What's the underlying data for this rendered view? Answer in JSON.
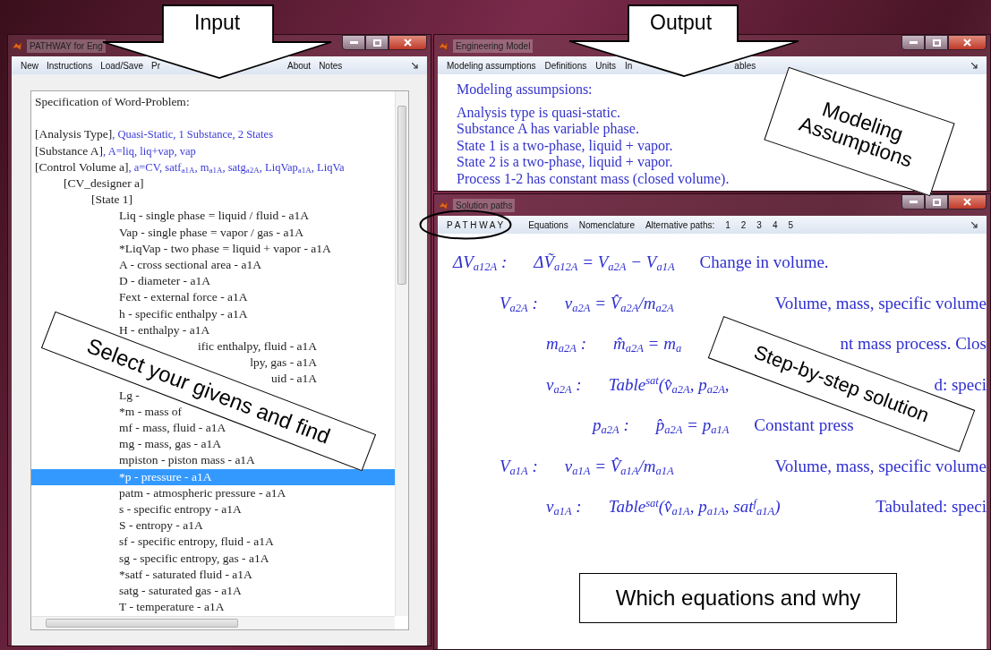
{
  "input_window": {
    "title": "PATHWAY for Eng",
    "menu": [
      "New",
      "Instructions",
      "Load/Save",
      "Pr",
      "About",
      "Notes"
    ],
    "heading": "Specification of Word-Problem:",
    "specs": [
      {
        "label": "[Analysis Type]",
        "value": ", Quasi-Static, 1 Substance, 2 States"
      },
      {
        "label": "[Substance A]",
        "value": ", A=liq, liq+vap, vap"
      },
      {
        "label": "[Control Volume a]",
        "value": ", a=CV, satf$_{a1A}$, m$_{a1A}$, satg$_{a2A}$, LiqVap$_{a1A}$, LiqVa"
      }
    ],
    "tree": [
      {
        "text": "[CV_designer a]",
        "selected": false,
        "children": [
          {
            "text": "[State 1]",
            "selected": false,
            "children": [
              {
                "text": "Liq - single phase = liquid / fluid - a1A",
                "selected": false,
                "kind": "entry"
              },
              {
                "text": "Vap - single phase = vapor / gas - a1A",
                "selected": false,
                "kind": "entry"
              },
              {
                "text": "*LiqVap - two phase = liquid + vapor - a1A",
                "selected": false,
                "kind": "entry"
              },
              {
                "text": "A - cross sectional area - a1A",
                "selected": false,
                "kind": "entry"
              },
              {
                "text": "D - diameter - a1A",
                "selected": false,
                "kind": "entry"
              },
              {
                "text": "Fext - external force - a1A",
                "selected": false,
                "kind": "entry"
              },
              {
                "text": "h - specific enthalpy - a1A",
                "selected": false,
                "kind": "entry"
              },
              {
                "text": "H - enthalpy - a1A",
                "selected": false,
                "kind": "entry"
              },
              {
                "text": "ific enthalpy, fluid - a1A",
                "selected": false,
                "kind": "tail"
              },
              {
                "text": "lpy, gas - a1A",
                "selected": false,
                "kind": "tail"
              },
              {
                "text": "uid - a1A",
                "selected": false,
                "kind": "tail"
              },
              {
                "text": "Lg -",
                "selected": false,
                "kind": "entry"
              },
              {
                "text": "*m - mass of",
                "selected": false,
                "kind": "entry"
              },
              {
                "text": "mf - mass, fluid - a1A",
                "selected": false,
                "kind": "entry"
              },
              {
                "text": "mg - mass, gas - a1A",
                "selected": false,
                "kind": "entry"
              },
              {
                "text": "mpiston - piston mass - a1A",
                "selected": false,
                "kind": "entry"
              },
              {
                "text": "*p - pressure - a1A",
                "selected": true,
                "kind": "entry"
              },
              {
                "text": "patm - atmospheric pressure - a1A",
                "selected": false,
                "kind": "entry"
              },
              {
                "text": "s - specific entropy - a1A",
                "selected": false,
                "kind": "entry"
              },
              {
                "text": "S - entropy - a1A",
                "selected": false,
                "kind": "entry"
              },
              {
                "text": "sf - specific entropy, fluid - a1A",
                "selected": false,
                "kind": "entry"
              },
              {
                "text": "sg - specific entropy, gas - a1A",
                "selected": false,
                "kind": "entry"
              },
              {
                "text": "*satf - saturated fluid - a1A",
                "selected": false,
                "kind": "entry"
              },
              {
                "text": "satg - saturated gas - a1A",
                "selected": false,
                "kind": "entry"
              },
              {
                "text": "T - temperature - a1A",
                "selected": false,
                "kind": "entry"
              }
            ]
          }
        ]
      }
    ]
  },
  "model_window": {
    "title": "Engineering Model",
    "menu": [
      "Modeling assumptions",
      "Definitions",
      "Units",
      "In",
      "ables"
    ],
    "heading": "Modeling assumpsions:",
    "assumptions": [
      "Analysis type is quasi-static.",
      "Substance A has variable phase.",
      "State 1 is a two-phase, liquid + vapor.",
      "State 2 is a two-phase, liquid + vapor.",
      "Process 1-2 has constant mass (closed volume)."
    ]
  },
  "solution_window": {
    "title": "Solution paths",
    "menu": [
      "P A T H W A Y",
      "Equations",
      "Nomenclature",
      "Alternative paths:",
      "1",
      "2",
      "3",
      "4",
      "5"
    ],
    "equations": [
      {
        "variable": "ΔV$_{a12A}$ :",
        "equation": "ΔṼ$_{a12A}$ = V$_{a2A}$ − V$_{a1A}$",
        "reason": "Change in volume.",
        "clipped": false,
        "children": [
          {
            "variable": "V$_{a2A}$ :",
            "equation": "v$_{a2A}$ = V̂$_{a2A}$/m$_{a2A}$",
            "reason": "Volume, mass, specific volume",
            "clipped": true,
            "children": [
              {
                "variable": "m$_{a2A}$ :",
                "equation": "m̂$_{a2A}$ = m$_{a}$",
                "reason": "nt mass process. Clos",
                "clipped": true
              },
              {
                "variable": "v$_{a2A}$ :",
                "equation": "Table$^{sat}$(v̂$_{a2A}$, p$_{a2A}$,",
                "reason": "d: speci",
                "clipped": true,
                "children": [
                  {
                    "variable": "p$_{a2A}$ :",
                    "equation": "p̂$_{a2A}$ = p$_{a1A}$",
                    "reason": "Constant press",
                    "clipped": false
                  }
                ]
              }
            ]
          },
          {
            "variable": "V$_{a1A}$ :",
            "equation": "v$_{a1A}$ = V̂$_{a1A}$/m$_{a1A}$",
            "reason": "Volume, mass, specific volume",
            "clipped": true,
            "children": [
              {
                "variable": "v$_{a1A}$ :",
                "equation": "Table$^{sat}$(v̂$_{a1A}$, p$_{a1A}$, sat$^{f}$$_{a1A}$)",
                "reason": "Tabulated: speci",
                "clipped": true
              }
            ]
          }
        ]
      }
    ]
  },
  "annotations": [
    {
      "kind": "arrow",
      "text": "Input"
    },
    {
      "kind": "arrow",
      "text": "Output"
    },
    {
      "kind": "tilted",
      "text": "Modeling Assumptions"
    },
    {
      "kind": "tilted",
      "text": "Select your givens and find"
    },
    {
      "kind": "tilted",
      "text": "Step-by-step solution"
    },
    {
      "kind": "box",
      "text": "Which equations and why"
    },
    {
      "kind": "ellipse"
    }
  ]
}
